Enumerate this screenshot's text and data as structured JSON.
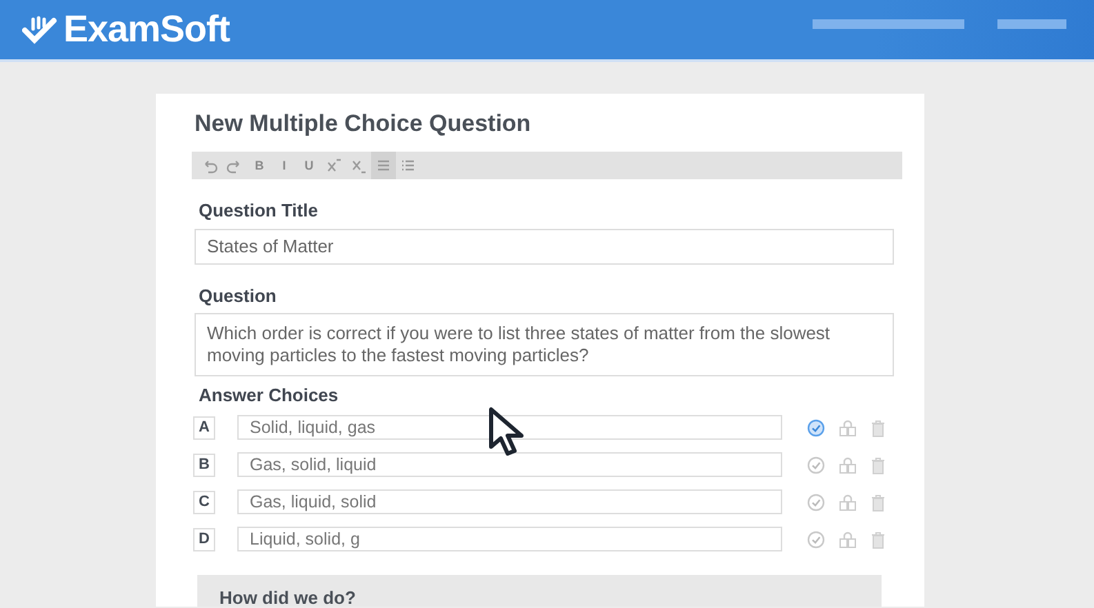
{
  "header": {
    "logo": "ExamSoft"
  },
  "editor": {
    "title": "New Multiple Choice Question",
    "toolbar": [
      {
        "kind": "icon",
        "selected": false
      },
      {
        "kind": "icon",
        "selected": false
      },
      {
        "kind": "letter",
        "label": "B",
        "selected": false
      },
      {
        "kind": "letter",
        "label": "I",
        "selected": false
      },
      {
        "kind": "letter",
        "label": "U",
        "selected": false
      },
      {
        "kind": "icon",
        "selected": false
      },
      {
        "kind": "icon",
        "selected": false
      },
      {
        "kind": "icon",
        "selected": true
      },
      {
        "kind": "icon",
        "selected": false
      }
    ],
    "question_title": {
      "label": "Question Title",
      "value": "States of Matter"
    },
    "question": {
      "label": "Question",
      "value": "Which order is correct if you were to list three states of matter from the slowest moving particles to the fastest moving particles?"
    },
    "answers_label": "Answer Choices",
    "answers": [
      {
        "letter": "A",
        "value": "Solid, liquid, gas",
        "correct": true
      },
      {
        "letter": "B",
        "value": "Gas, solid, liquid",
        "correct": false
      },
      {
        "letter": "C",
        "value": "Gas, liquid, solid",
        "correct": false
      },
      {
        "letter": "D",
        "value": "Liquid, solid, g",
        "correct": false
      }
    ],
    "feedback": {
      "title": "How did we do?"
    }
  }
}
